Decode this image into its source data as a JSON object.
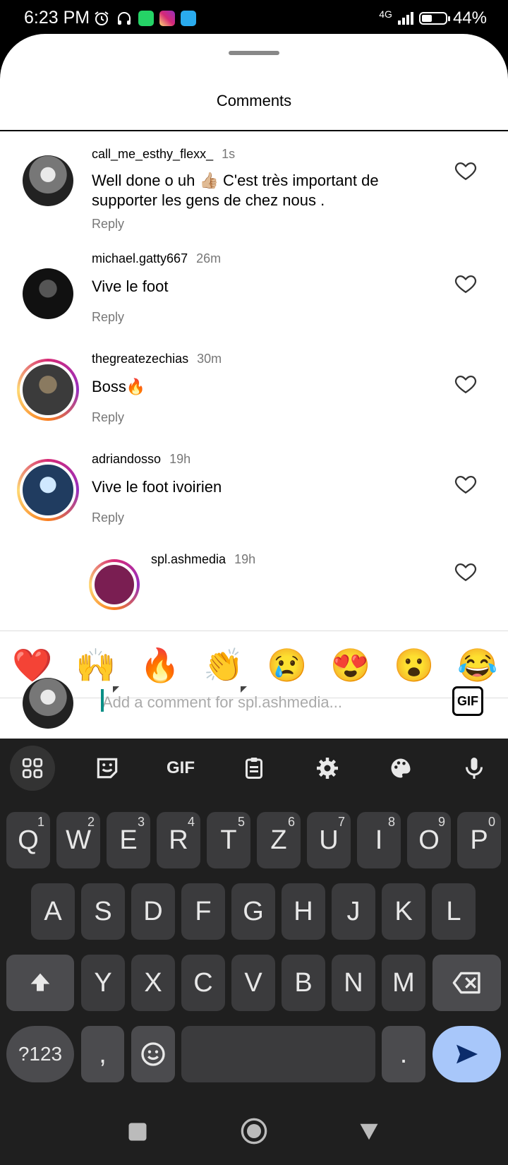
{
  "status_bar": {
    "time": "6:23 PM",
    "network": "4G",
    "battery": "44%",
    "battery_level": 0.44,
    "icons": [
      "alarm-icon",
      "headphones-icon",
      "whatsapp-icon",
      "instagram-icon",
      "telegram-icon",
      "signal-icon",
      "battery-icon"
    ]
  },
  "sheet": {
    "title": "Comments"
  },
  "comments": [
    {
      "username": "call_me_esthy_flexx_",
      "time": "1s",
      "text": "Well done o uh 👍🏼 C'est très important de supporter  les gens de chez  nous .",
      "reply_label": "Reply"
    },
    {
      "username": "michael.gatty667",
      "time": "26m",
      "text": "Vive le foot",
      "reply_label": "Reply"
    },
    {
      "username": "thegreatezechias",
      "time": "30m",
      "text": "Boss🔥",
      "reply_label": "Reply"
    },
    {
      "username": "adriandosso",
      "time": "19h",
      "text": "Vive le foot ivoirien",
      "reply_label": "Reply"
    },
    {
      "username": "spl.ashmedia",
      "time": "19h"
    }
  ],
  "emoji_bar": [
    "❤️",
    "🙌",
    "🔥",
    "👏",
    "😢",
    "😍",
    "😮",
    "😂"
  ],
  "composer": {
    "placeholder": "Add a comment for spl.ashmedia...",
    "gif_label": "GIF"
  },
  "keyboard": {
    "toolbar": [
      "apps-icon",
      "sticker-icon",
      "gif-icon",
      "clipboard-icon",
      "settings-icon",
      "palette-icon",
      "mic-icon"
    ],
    "toolbar_gif_label": "GIF",
    "row1": [
      {
        "key": "Q",
        "hint": "1"
      },
      {
        "key": "W",
        "hint": "2"
      },
      {
        "key": "E",
        "hint": "3"
      },
      {
        "key": "R",
        "hint": "4"
      },
      {
        "key": "T",
        "hint": "5"
      },
      {
        "key": "Z",
        "hint": "6"
      },
      {
        "key": "U",
        "hint": "7"
      },
      {
        "key": "I",
        "hint": "8"
      },
      {
        "key": "O",
        "hint": "9"
      },
      {
        "key": "P",
        "hint": "0"
      }
    ],
    "row2": [
      "A",
      "S",
      "D",
      "F",
      "G",
      "H",
      "J",
      "K",
      "L"
    ],
    "row3": [
      "Y",
      "X",
      "C",
      "V",
      "B",
      "N",
      "M"
    ],
    "symbols_label": "?123",
    "comma": ",",
    "period": "."
  },
  "colors": {
    "accent_blue": "#a8c7fa",
    "cursor": "#0a8f86",
    "keyboard_bg": "#1f1f1f",
    "key_bg": "#3b3b3d"
  }
}
